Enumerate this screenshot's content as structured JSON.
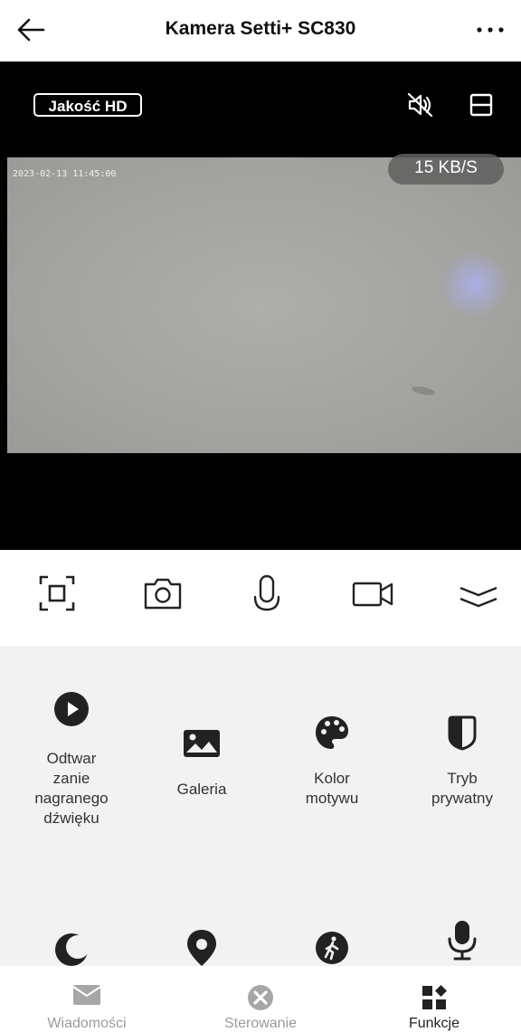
{
  "header": {
    "title": "Kamera Setti+ SC830",
    "back_icon": "arrow-left-icon",
    "more_icon": "more-horizontal-icon"
  },
  "video": {
    "quality_label": "Jakość HD",
    "timestamp": "2023-02-13 11:45:00",
    "bitrate": "15 KB/S",
    "mute_icon": "speaker-muted-icon",
    "layout_icon": "split-view-icon"
  },
  "toolbar": {
    "items": [
      "fullscreen-icon",
      "camera-snapshot-icon",
      "microphone-icon",
      "video-record-icon",
      "collapse-chevrons-icon"
    ]
  },
  "features": [
    {
      "label": "Odtwar\nzanie\nnagranego\ndźwięku",
      "icon": "play-circle-icon"
    },
    {
      "label": "Galeria",
      "icon": "gallery-icon"
    },
    {
      "label": "Kolor\nmotywu",
      "icon": "palette-icon"
    },
    {
      "label": "Tryb\nprywatny",
      "icon": "privacy-shield-icon"
    },
    {
      "label": "",
      "icon": "night-moon-icon"
    },
    {
      "label": "",
      "icon": "location-pin-icon"
    },
    {
      "label": "",
      "icon": "motion-walk-icon"
    },
    {
      "label": "",
      "icon": "microphone-stand-icon"
    }
  ],
  "tabs": [
    {
      "label": "Wiadomości",
      "icon": "envelope-icon",
      "active": false
    },
    {
      "label": "Sterowanie",
      "icon": "control-x-icon",
      "active": false
    },
    {
      "label": "Funkcje",
      "icon": "grid-functions-icon",
      "active": true
    }
  ],
  "colors": {
    "accent": "#222222",
    "inactive": "#9a9a9a",
    "video_bg": "#000000",
    "panel_bg": "#f2f2f2"
  }
}
